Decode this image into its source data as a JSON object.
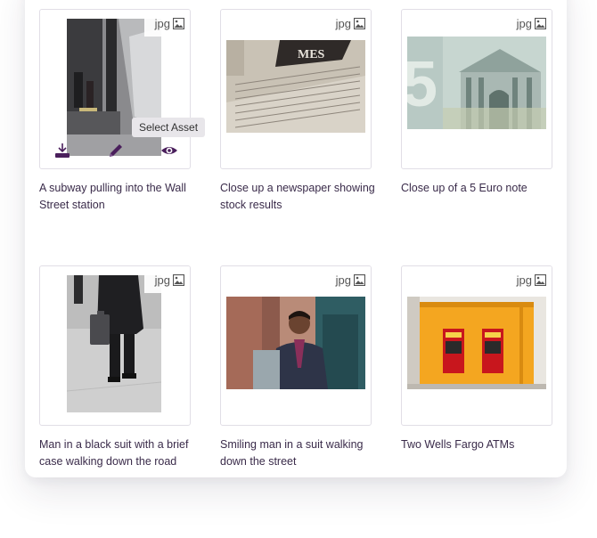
{
  "assets": [
    {
      "type": "jpg",
      "caption": "A subway pulling into the Wall Street station"
    },
    {
      "type": "jpg",
      "caption": "Close up a newspaper showing stock results"
    },
    {
      "type": "jpg",
      "caption": "Close up of a 5 Euro note"
    },
    {
      "type": "jpg",
      "caption": "Man in a black suit with a brief case walking down the road"
    },
    {
      "type": "jpg",
      "caption": "Smiling man in a suit walking down the street"
    },
    {
      "type": "jpg",
      "caption": "Two Wells Fargo ATMs"
    }
  ],
  "hover_actions": {
    "tooltip": "Select Asset",
    "icons": [
      "download-icon",
      "edit-pencil-icon",
      "eye-icon"
    ]
  },
  "colors": {
    "accent": "#4a1f5c",
    "caption_text": "#3a2b4a",
    "card_border": "#e1dee6"
  }
}
